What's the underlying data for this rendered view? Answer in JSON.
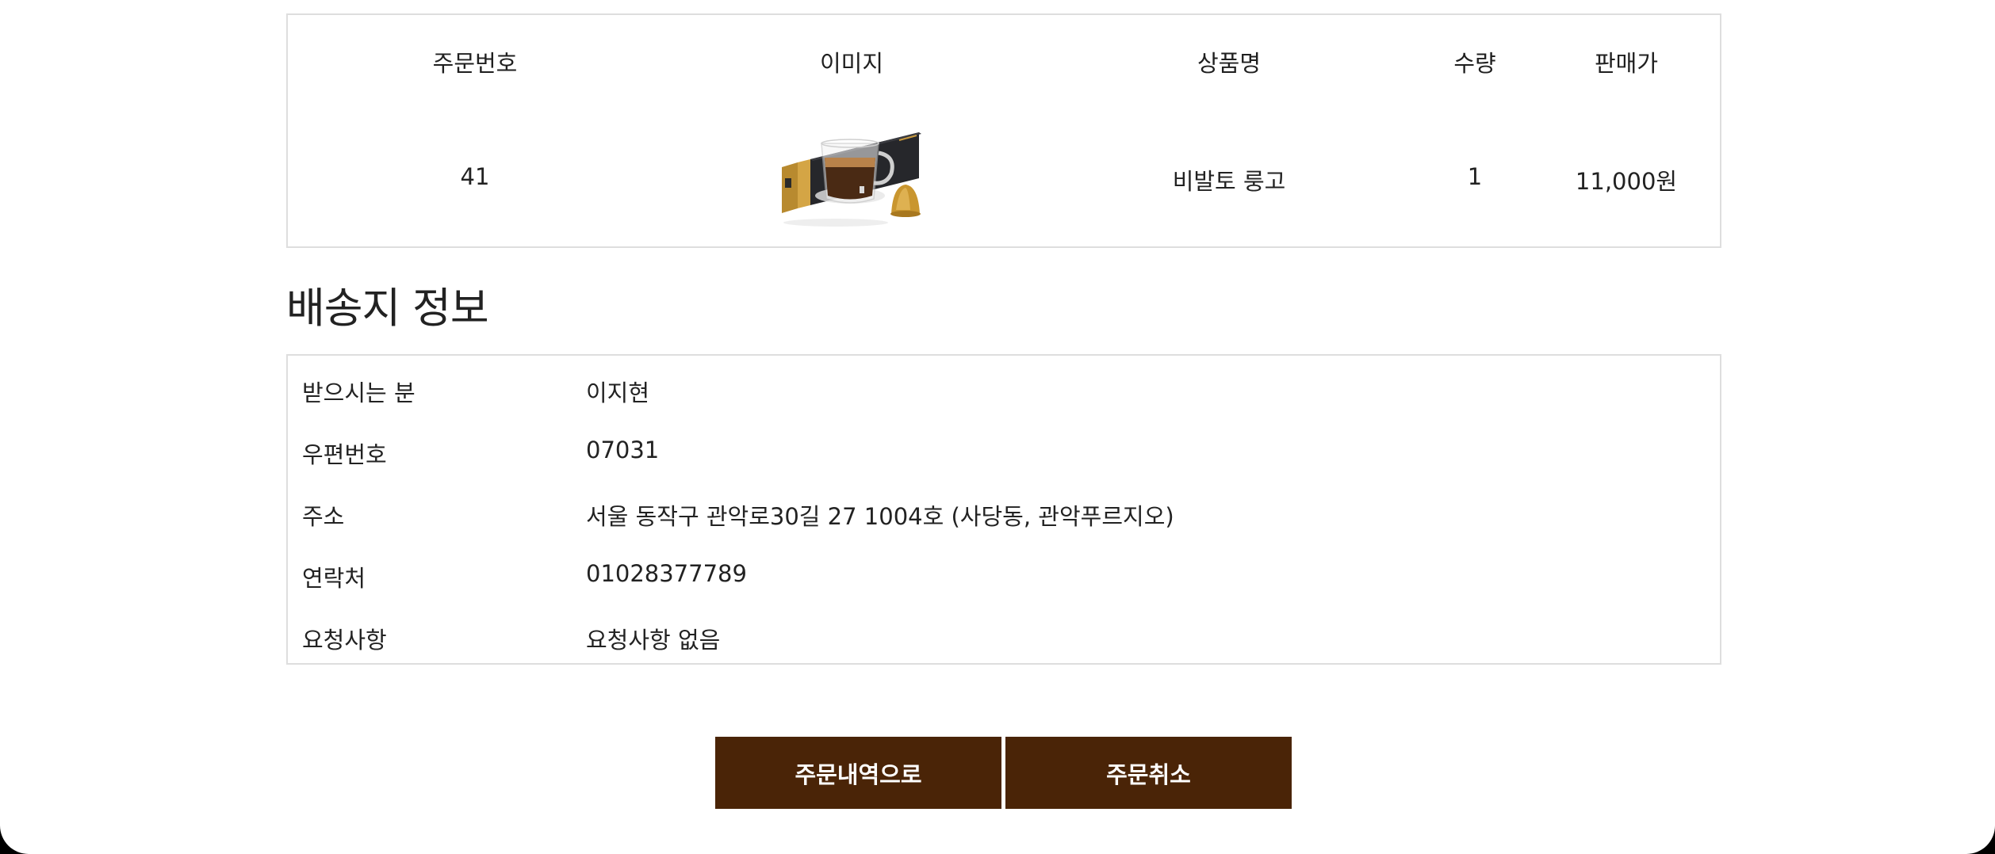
{
  "order_table": {
    "headers": [
      "주문번호",
      "이미지",
      "상품명",
      "수량",
      "판매가"
    ],
    "rows": [
      {
        "order_no": "41",
        "image": "nespresso-capsule-product-image",
        "product_name": "비발토 룽고",
        "quantity": "1",
        "price": "11,000원"
      }
    ]
  },
  "shipping": {
    "title": "배송지 정보",
    "rows": [
      {
        "label": "받으시는 분",
        "value": "이지현"
      },
      {
        "label": "우편번호",
        "value": "07031"
      },
      {
        "label": "주소",
        "value": "서울 동작구 관악로30길 27 1004호 (사당동, 관악푸르지오)"
      },
      {
        "label": "연락처",
        "value": "01028377789"
      },
      {
        "label": "요청사항",
        "value": "요청사항 없음"
      }
    ]
  },
  "buttons": {
    "history_label": "주문내역으로",
    "cancel_label": "주문취소"
  },
  "colors": {
    "button_bg": "#4a2407",
    "button_text": "#ffffff",
    "border": "#dedede",
    "text": "#222222"
  }
}
